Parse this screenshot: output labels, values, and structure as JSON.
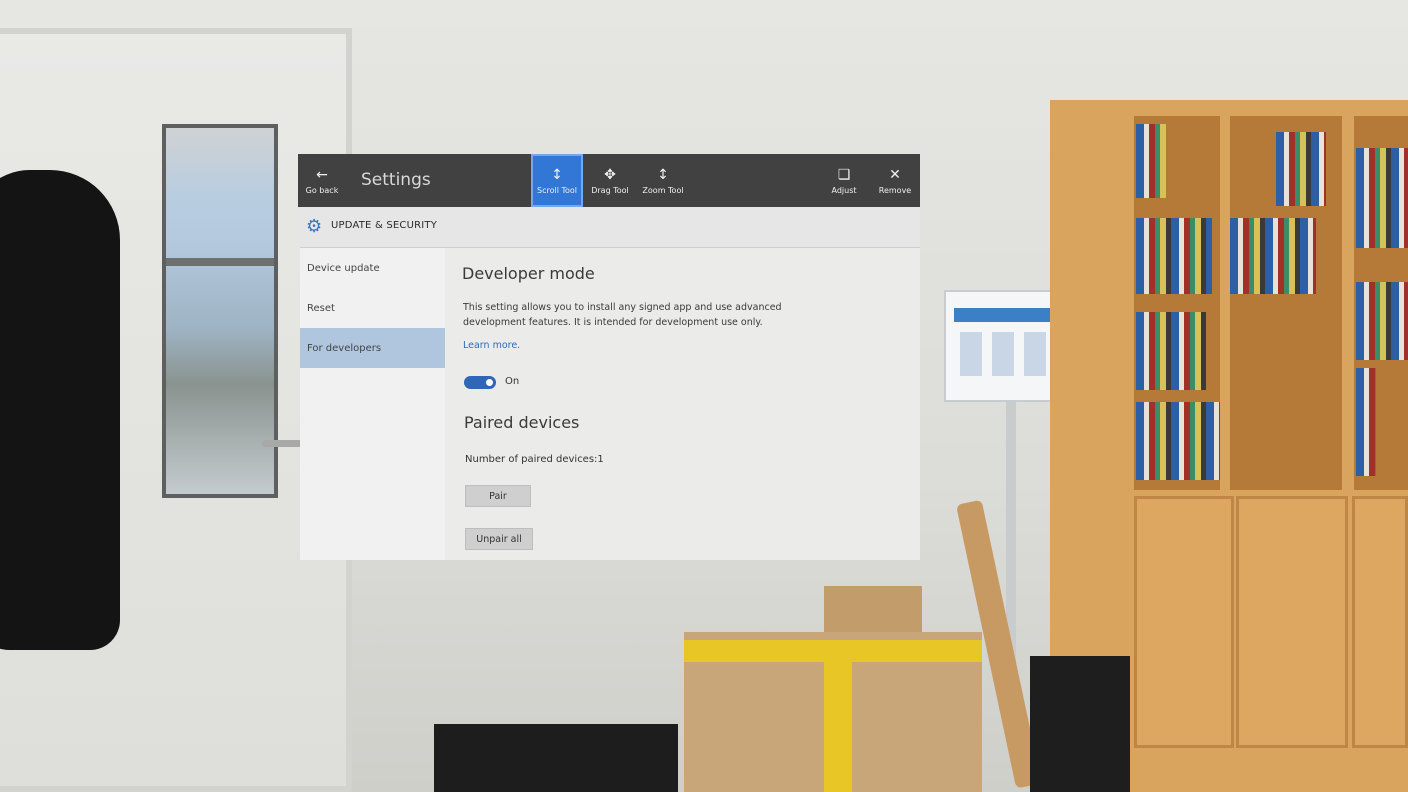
{
  "toolbar": {
    "back": {
      "icon": "back-arrow-icon",
      "label": "Go back"
    },
    "title": "Settings",
    "tools": [
      {
        "name": "scroll-tool",
        "icon": "scroll-icon",
        "label": "Scroll Tool",
        "active": true
      },
      {
        "name": "drag-tool",
        "icon": "drag-icon",
        "label": "Drag Tool",
        "active": false
      },
      {
        "name": "zoom-tool",
        "icon": "zoom-icon",
        "label": "Zoom Tool",
        "active": false
      }
    ],
    "adjust": {
      "icon": "adjust-icon",
      "label": "Adjust"
    },
    "remove": {
      "icon": "remove-icon",
      "label": "Remove"
    },
    "accent_color": "#3277d6"
  },
  "header": {
    "icon": "gear-icon",
    "title": "UPDATE & SECURITY"
  },
  "sidebar": {
    "items": [
      {
        "label": "Device update"
      },
      {
        "label": "Reset"
      },
      {
        "label": "For developers",
        "selected": true
      }
    ]
  },
  "developer_mode": {
    "heading": "Developer mode",
    "description": "This setting allows you to install any signed app and use advanced development features. It is intended for development use only.",
    "link": "Learn more.",
    "toggle_state": "On"
  },
  "paired_devices": {
    "heading": "Paired devices",
    "count_text": "Number of paired devices:1",
    "pair_button": "Pair",
    "unpair_button": "Unpair all"
  }
}
